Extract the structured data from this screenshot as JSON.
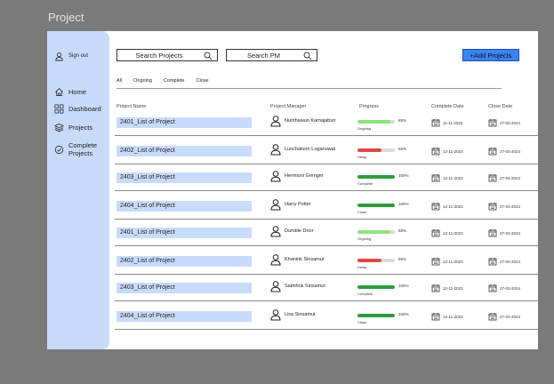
{
  "page": {
    "title": "Project"
  },
  "sidebar": {
    "sign_out": "Sign out",
    "items": [
      {
        "label": "Home",
        "icon": "home-icon"
      },
      {
        "label": "Dashboard",
        "icon": "dashboard-icon"
      },
      {
        "label": "Projects",
        "icon": "layers-icon"
      },
      {
        "label": "Complete Projects",
        "icon": "check-circle-icon"
      }
    ]
  },
  "toolbar": {
    "search_projects": "Search Projects",
    "search_pm": "Search PM",
    "add_label": "+Add Projects"
  },
  "filters": [
    "All",
    "Ongoing",
    "Complete",
    "Close"
  ],
  "table": {
    "headers": {
      "name": "Project Name",
      "pm": "Project Manager",
      "progress": "Progress",
      "complete_date": "Complete Date",
      "close_date": "Close Date"
    },
    "rows": [
      {
        "name": "2401_List of Project",
        "pm": "Nunthawun Karnajaburi",
        "progress": 88,
        "pct_label": "88%",
        "status": "Ongoing",
        "bar_color": "#8ee37a",
        "complete": "11-11-2023",
        "close": "27-03-2024"
      },
      {
        "name": "2402_List of Project",
        "pm": "Lunchakorn Loganuwat",
        "progress": 65,
        "pct_label": "65%",
        "status": "Delay",
        "bar_color": "#e04848",
        "complete": "12-11-2023",
        "close": "27-03-2024"
      },
      {
        "name": "2403_List of Project",
        "pm": "Hermioni Grenger",
        "progress": 100,
        "pct_label": "100%",
        "status": "Complete",
        "bar_color": "#2e9a3c",
        "complete": "12-11-2023",
        "close": "27-03-2024"
      },
      {
        "name": "2404_List of Project",
        "pm": "Harry Potter",
        "progress": 100,
        "pct_label": "100%",
        "status": "Close",
        "bar_color": "#2e9a3c",
        "complete": "12-11-2023",
        "close": "27-03-2024"
      },
      {
        "name": "2401_List of Project",
        "pm": "Dumble Door",
        "progress": 88,
        "pct_label": "88%",
        "status": "Ongoing",
        "bar_color": "#8ee37a",
        "complete": "12-11-2023",
        "close": "27-03-2024"
      },
      {
        "name": "2402_List of Project",
        "pm": "Khanink Sinsamut",
        "progress": 65,
        "pct_label": "65%",
        "status": "Delay",
        "bar_color": "#e04848",
        "complete": "12-11-2023",
        "close": "27-03-2024"
      },
      {
        "name": "2403_List of Project",
        "pm": "Saimhok Sinsamut",
        "progress": 100,
        "pct_label": "100%",
        "status": "Complete",
        "bar_color": "#2e9a3c",
        "complete": "12-11-2023",
        "close": "27-03-2024"
      },
      {
        "name": "2404_List of Project",
        "pm": "Lisa Sinsamut",
        "progress": 100,
        "pct_label": "100%",
        "status": "Close",
        "bar_color": "#2e9a3c",
        "complete": "12-11-2023",
        "close": "27-03-2024"
      }
    ]
  }
}
